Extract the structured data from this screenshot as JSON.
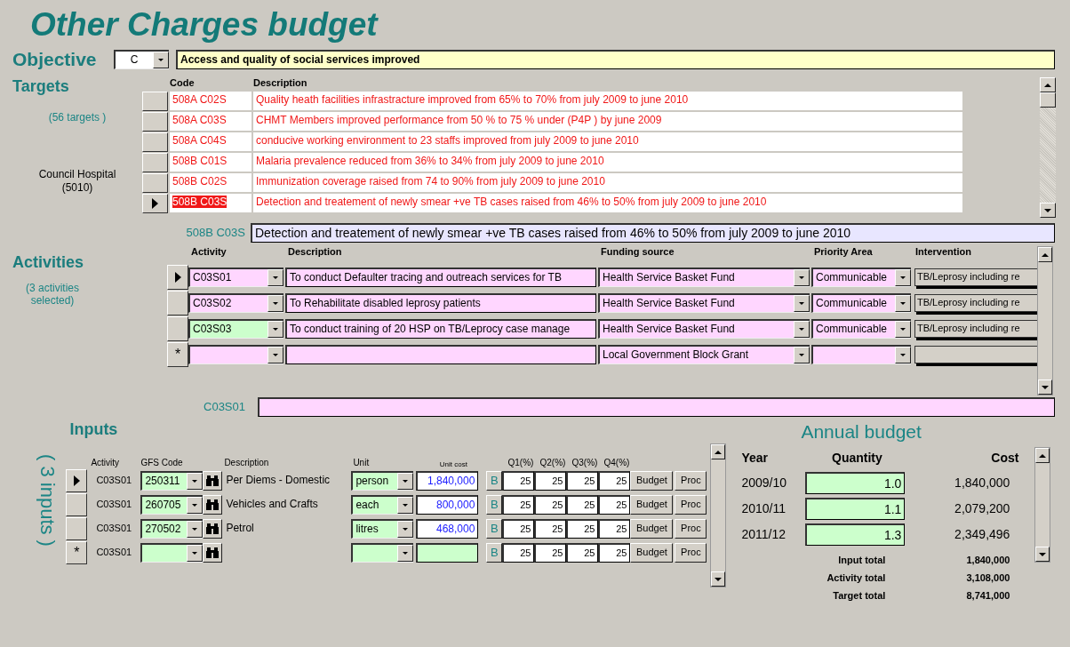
{
  "title": "Other Charges budget",
  "objective": {
    "label": "Objective",
    "code": "C",
    "text": "Access and quality of social services improved"
  },
  "targets": {
    "heading": "Targets",
    "count": "(56 targets )",
    "unit_name": "Council Hospital",
    "unit_code": "(5010)",
    "columns": [
      "Code",
      "Description"
    ],
    "rows": [
      {
        "code": "508A C02S",
        "description": "Quality heath facilities infrastracture improved from 65% to 70% from july 2009 to june 2010",
        "selected": false
      },
      {
        "code": "508A C03S",
        "description": "CHMT Members improved performance from 50 % to 75 % under  (P4P ) by june 2009",
        "selected": false
      },
      {
        "code": "508A C04S",
        "description": "conducive working environment to 23 staffs improved from  july 2009 to june 2010",
        "selected": false
      },
      {
        "code": "508B C01S",
        "description": "Malaria prevalence reduced from 36% to 34% from july 2009 to june 2010",
        "selected": false
      },
      {
        "code": "508B C02S",
        "description": "Immunization coverage raised from 74  to 90% from july 2009 to june 2010",
        "selected": false
      },
      {
        "code": "508B C03S",
        "description": "Detection and treatement of newly smear +ve TB  cases  raised  from 46% to 50% from july 2009 to june 2010",
        "selected": true
      }
    ],
    "detail_code": "508B C03S",
    "detail_text": "Detection and treatement of newly smear +ve TB  cases  raised  from 46% to 50% from july 2009 to june 2010"
  },
  "activities": {
    "heading": "Activities",
    "count": "(3 activities selected)",
    "columns": [
      "Activity",
      "Description",
      "Funding source",
      "Priority Area",
      "Intervention"
    ],
    "rows": [
      {
        "current": true,
        "activity": "C03S01",
        "highlighted": false,
        "description": "To conduct Defaulter tracing and outreach services for TB",
        "funding": "Health Service Basket Fund",
        "priority": "Communicable",
        "intervention": "TB/Leprosy including re"
      },
      {
        "current": false,
        "activity": "C03S02",
        "highlighted": false,
        "description": "To Rehabilitate disabled leprosy patients",
        "funding": "Health Service Basket Fund",
        "priority": "Communicable",
        "intervention": "TB/Leprosy including re"
      },
      {
        "current": false,
        "activity": "C03S03",
        "highlighted": true,
        "description": "To conduct training of 20 HSP on TB/Leprocy case manage",
        "funding": "Health Service Basket Fund",
        "priority": "Communicable",
        "intervention": "TB/Leprosy including re"
      },
      {
        "current": false,
        "marker": "*",
        "highlighted": false,
        "funding": "Local Government Block Grant"
      }
    ],
    "current_code": "C03S01"
  },
  "inputs": {
    "heading": "Inputs",
    "count": "( 3 inputs )",
    "columns": [
      "Activity",
      "GFS Code",
      "Description",
      "Unit",
      "Unit cost",
      "Q1(%)",
      "Q2(%)",
      "Q3(%)",
      "Q4(%)"
    ],
    "rows": [
      {
        "current": true,
        "activity": "C03S01",
        "gfs": "250311",
        "description": "Per Diems - Domestic",
        "unit": "person",
        "unit_cost": "1,840,000",
        "b": "B",
        "quarters": [
          "25",
          "25",
          "25",
          "25"
        ],
        "budget": "Budget",
        "proc": "Proc"
      },
      {
        "current": false,
        "activity": "C03S01",
        "gfs": "260705",
        "description": "Vehicles and Crafts",
        "unit": "each",
        "unit_cost": "800,000",
        "b": "B",
        "quarters": [
          "25",
          "25",
          "25",
          "25"
        ],
        "budget": "Budget",
        "proc": "Proc"
      },
      {
        "current": false,
        "activity": "C03S01",
        "gfs": "270502",
        "description": "Petrol",
        "unit": "litres",
        "unit_cost": "468,000",
        "b": "B",
        "quarters": [
          "25",
          "25",
          "25",
          "25"
        ],
        "budget": "Budget",
        "proc": "Proc"
      },
      {
        "current": false,
        "marker": "*",
        "activity": "C03S01",
        "b": "B",
        "quarters": [
          "25",
          "25",
          "25",
          "25"
        ],
        "budget": "Budget",
        "proc": "Proc"
      }
    ]
  },
  "annual_budget": {
    "heading": "Annual budget",
    "columns": [
      "Year",
      "Quantity",
      "Cost"
    ],
    "rows": [
      {
        "year": "2009/10",
        "quantity": "1.0",
        "cost": "1,840,000"
      },
      {
        "year": "2010/11",
        "quantity": "1.1",
        "cost": "2,079,200"
      },
      {
        "year": "2011/12",
        "quantity": "1.3",
        "cost": "2,349,496"
      }
    ],
    "totals": [
      {
        "label": "Input total",
        "value": "1,840,000"
      },
      {
        "label": "Activity total",
        "value": "3,108,000"
      },
      {
        "label": "Target total",
        "value": "8,741,000"
      }
    ]
  }
}
